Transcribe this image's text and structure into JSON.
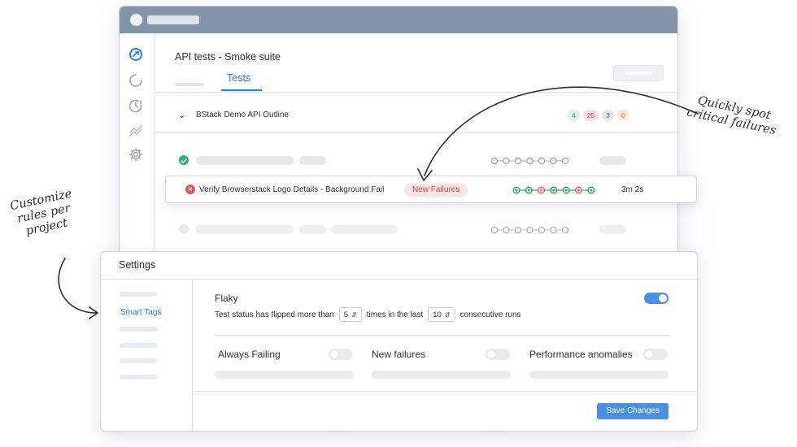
{
  "window": {
    "page_title": "API tests - Smoke suite",
    "active_tab": "Tests",
    "rail_icons": [
      "tests-icon",
      "loading-icon",
      "timer-alert-icon",
      "trend-icon",
      "gear-icon"
    ]
  },
  "group": {
    "name": "BStack Demo API Outline",
    "counts": {
      "passed": "4",
      "failed": "25",
      "skipped": "3",
      "other": "0"
    }
  },
  "highlight_row": {
    "name": "Verify Browserstack Logo Details - Background Fail",
    "badge": "New Failures",
    "duration": "3m 2s",
    "run_history": [
      "pass",
      "pass",
      "fail",
      "pass",
      "pass",
      "fail",
      "pass"
    ]
  },
  "settings": {
    "title": "Settings",
    "active_side_item": "Smart Tags",
    "flaky": {
      "title": "Flaky",
      "enabled": true,
      "desc_prefix": "Test status has flipped more than",
      "flips": "5",
      "desc_middle": "times in the last",
      "runs": "10",
      "desc_suffix": "consecutive runs"
    },
    "rules": [
      {
        "label": "Always Failing",
        "enabled": false
      },
      {
        "label": "New failures",
        "enabled": false
      },
      {
        "label": "Performance anomalies",
        "enabled": false
      }
    ],
    "save_label": "Save Changes"
  },
  "annotations": {
    "quickly_spot": "Quickly spot critical failures",
    "customize_rules": "Customize rules per project"
  },
  "colors": {
    "accent": "#2d7dd2",
    "pass": "#2a9d5c",
    "fail": "#e05a5a",
    "titlebar": "#8595a9"
  }
}
